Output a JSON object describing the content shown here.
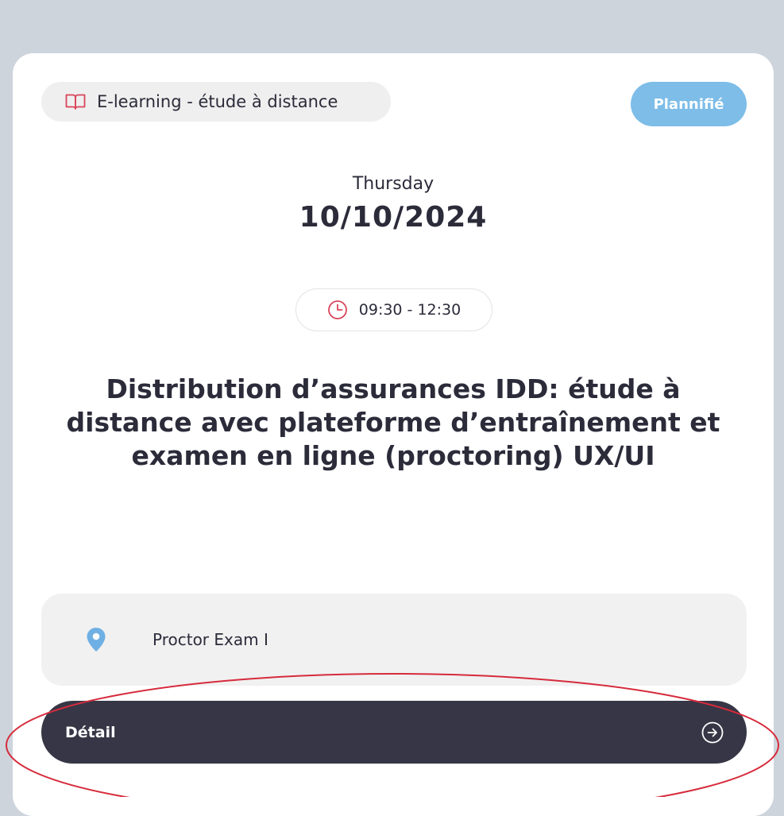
{
  "card": {
    "type_label": "E-learning - étude à distance",
    "type_icon": "book-open-icon",
    "status": "Plannifié",
    "weekday": "Thursday",
    "date": "10/10/2024",
    "time_range": "09:30 - 12:30",
    "time_icon": "clock-icon",
    "title": "Distribution d’assurances IDD: étude à distance avec plateforme d’entraînement et examen en ligne (proctoring) UX/UI",
    "location": "Proctor Exam I",
    "location_icon": "map-pin-icon",
    "detail_label": "Détail",
    "detail_icon": "arrow-right-circle-icon"
  },
  "colors": {
    "page_background": "#cdd4dc",
    "card_background": "#ffffff",
    "status_badge": "#7dbde8",
    "accent_red": "#d9455a",
    "pin_blue": "#6fb0e4",
    "button_dark": "#363646",
    "annotation_red": "#d62b3c"
  }
}
